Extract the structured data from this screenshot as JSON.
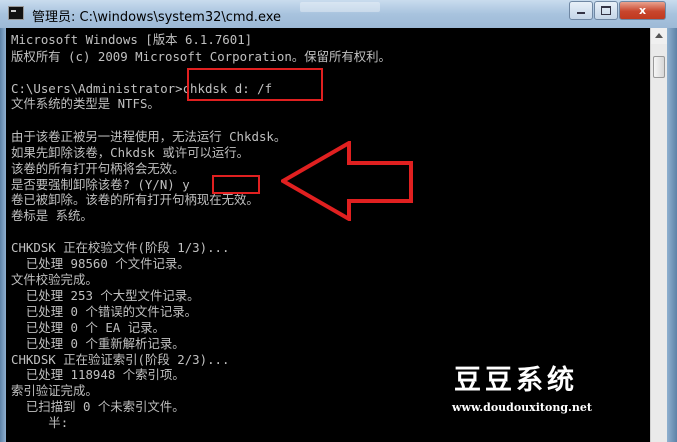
{
  "window": {
    "title": "管理员: C:\\windows\\system32\\cmd.exe",
    "ghost_tab_text": "...",
    "minimize_label": "",
    "maximize_label": "",
    "close_label": "x"
  },
  "console": {
    "lines": [
      "Microsoft Windows [版本 6.1.7601]",
      "版权所有 (c) 2009 Microsoft Corporation。保留所有权利。",
      "",
      "C:\\Users\\Administrator>chkdsk d: /f",
      "文件系统的类型是 NTFS。",
      "",
      "由于该卷正被另一进程使用，无法运行 Chkdsk。",
      "如果先卸除该卷，Chkdsk 或许可以运行。",
      "该卷的所有打开句柄将会无效。",
      "是否要强制卸除该卷? (Y/N) y",
      "卷已被卸除。该卷的所有打开句柄现在无效。",
      "卷标是 系统。",
      "",
      "CHKDSK 正在校验文件(阶段 1/3)...",
      "  已处理 98560 个文件记录。",
      "文件校验完成。",
      "  已处理 253 个大型文件记录。",
      "  已处理 0 个错误的文件记录。",
      "  已处理 0 个 EA 记录。",
      "  已处理 0 个重新解析记录。",
      "CHKDSK 正在验证索引(阶段 2/3)...",
      "  已处理 118948 个索引项。",
      "索引验证完成。",
      "  已扫描到 0 个未索引文件。",
      "     半:"
    ]
  },
  "watermark": {
    "title": "豆豆系统",
    "url": "www.doudouxitong.net"
  },
  "annotations": {
    "color": "#e02020"
  }
}
